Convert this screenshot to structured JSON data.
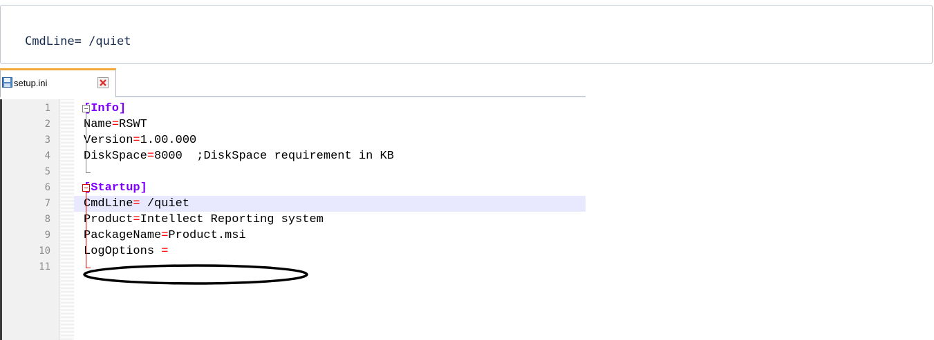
{
  "code_block": {
    "text": "CmdLine= /quiet"
  },
  "editor": {
    "tab": {
      "label": "setup.ini",
      "icon": "save-icon",
      "close_icon": "close-icon",
      "accent_color": "#f3a93a"
    },
    "colors": {
      "section": "#8000ff",
      "equals": "#ff0000",
      "fold_info": "#808080",
      "fold_startup": "#e00000",
      "current_line": "#e8e8ff"
    },
    "lines": [
      {
        "num": "1",
        "key": "",
        "eq": "",
        "value": "",
        "section": "[Info]"
      },
      {
        "num": "2",
        "key": "Name",
        "eq": "=",
        "value": "RSWT",
        "section": ""
      },
      {
        "num": "3",
        "key": "Version",
        "eq": "=",
        "value": "1.00.000",
        "section": ""
      },
      {
        "num": "4",
        "key": "DiskSpace",
        "eq": "=",
        "value": "8000  ;DiskSpace requirement in KB",
        "section": ""
      },
      {
        "num": "5",
        "key": "",
        "eq": "",
        "value": "",
        "section": ""
      },
      {
        "num": "6",
        "key": "",
        "eq": "",
        "value": "",
        "section": "[Startup]"
      },
      {
        "num": "7",
        "key": "CmdLine",
        "eq": "=",
        "value": " /quiet",
        "section": ""
      },
      {
        "num": "8",
        "key": "Product",
        "eq": "=",
        "value": "Intellect Reporting system",
        "section": ""
      },
      {
        "num": "9",
        "key": "PackageName",
        "eq": "=",
        "value": "Product.msi",
        "section": ""
      },
      {
        "num": "10",
        "key": "LogOptions ",
        "eq": "=",
        "value": "",
        "section": ""
      },
      {
        "num": "11",
        "key": "",
        "eq": "",
        "value": "",
        "section": ""
      }
    ]
  }
}
